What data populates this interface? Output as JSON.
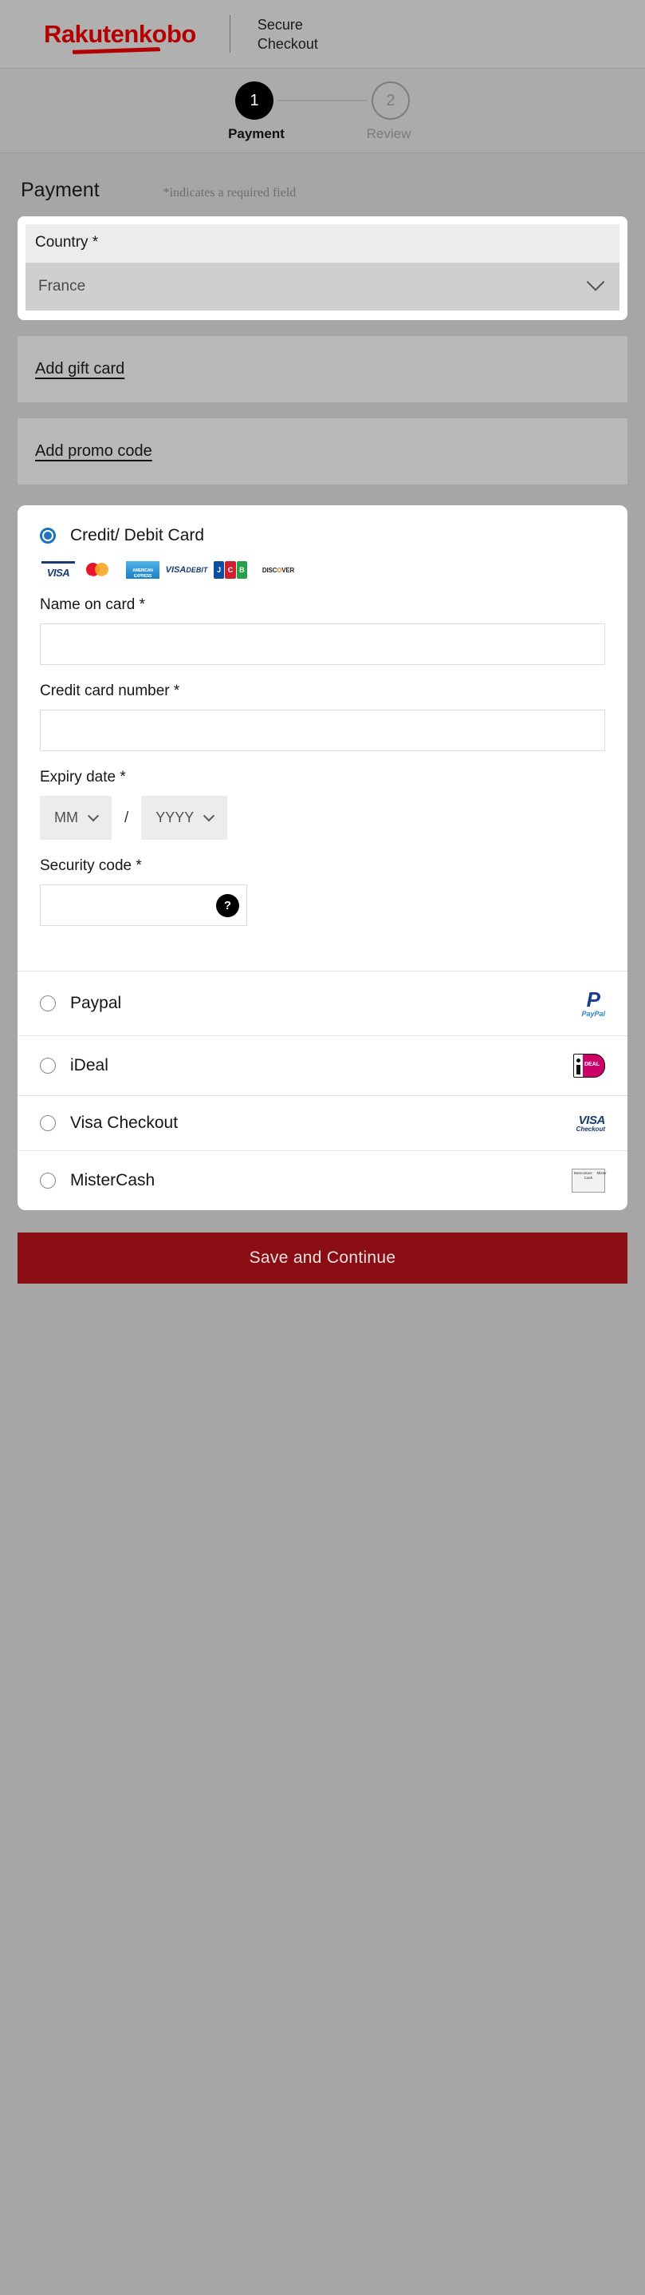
{
  "header": {
    "brand_primary": "Rakuten",
    "brand_secondary": "kobo",
    "secure_line1": "Secure",
    "secure_line2": "Checkout",
    "brand_color": "#b30000"
  },
  "stepper": {
    "steps": [
      {
        "number": "1",
        "label": "Payment",
        "state": "active"
      },
      {
        "number": "2",
        "label": "Review",
        "state": "inactive"
      }
    ]
  },
  "payment_section": {
    "title": "Payment",
    "required_note": "*indicates a required field"
  },
  "country": {
    "label": "Country *",
    "value": "France",
    "chevron": "chevron-down-icon"
  },
  "links": {
    "gift_card": "Add gift card",
    "promo_code": "Add promo code"
  },
  "credit_card": {
    "option_label": "Credit/ Debit Card",
    "selected": true,
    "accent_color": "#1e73be",
    "accepted_brands": [
      "VISA",
      "MasterCard",
      "American Express",
      "VISA DEBIT",
      "JCB",
      "DISCOVER"
    ],
    "fields": {
      "name_label": "Name on card *",
      "name_value": "",
      "number_label": "Credit card number *",
      "number_value": "",
      "expiry_label": "Expiry date *",
      "expiry_month": "MM",
      "expiry_year": "YYYY",
      "expiry_separator": "/",
      "security_label": "Security code *",
      "security_value": "",
      "security_help": "?"
    }
  },
  "alt_methods": [
    {
      "label": "Paypal",
      "selected": false,
      "logo": "paypal-logo"
    },
    {
      "label": "iDeal",
      "selected": false,
      "logo": "ideal-logo"
    },
    {
      "label": "Visa Checkout",
      "selected": false,
      "logo": "visa-checkout-logo"
    },
    {
      "label": "MisterCash",
      "selected": false,
      "logo": "mistercash-logo"
    }
  ],
  "submit": {
    "label": "Save and Continue",
    "color": "#8b0d14"
  }
}
